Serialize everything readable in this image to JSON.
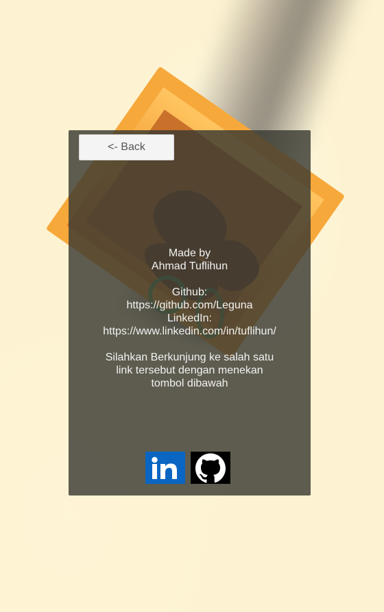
{
  "back_button": {
    "label": "<- Back"
  },
  "info": {
    "made_by_label": "Made by",
    "author": "Ahmad Tuflihun",
    "github_label": "Github:",
    "github_url": "https://github.com/Leguna",
    "linkedin_label": "LinkedIn:",
    "linkedin_url": "https://www.linkedin.com/in/tuflihun/",
    "message_lines": [
      "Silahkan Berkunjung ke salah satu",
      "link tersebut dengan menekan",
      "tombol dibawah"
    ]
  },
  "social_buttons": [
    {
      "name": "linkedin",
      "icon": "linkedin-icon",
      "color": "#0a66c2"
    },
    {
      "name": "github",
      "icon": "github-icon",
      "color": "#000000"
    }
  ],
  "colors": {
    "background": "#fdf3d2",
    "panel": "rgba(58,58,50,0.82)",
    "box_orange": "#f7a83b",
    "text": "#f2f2f2"
  }
}
